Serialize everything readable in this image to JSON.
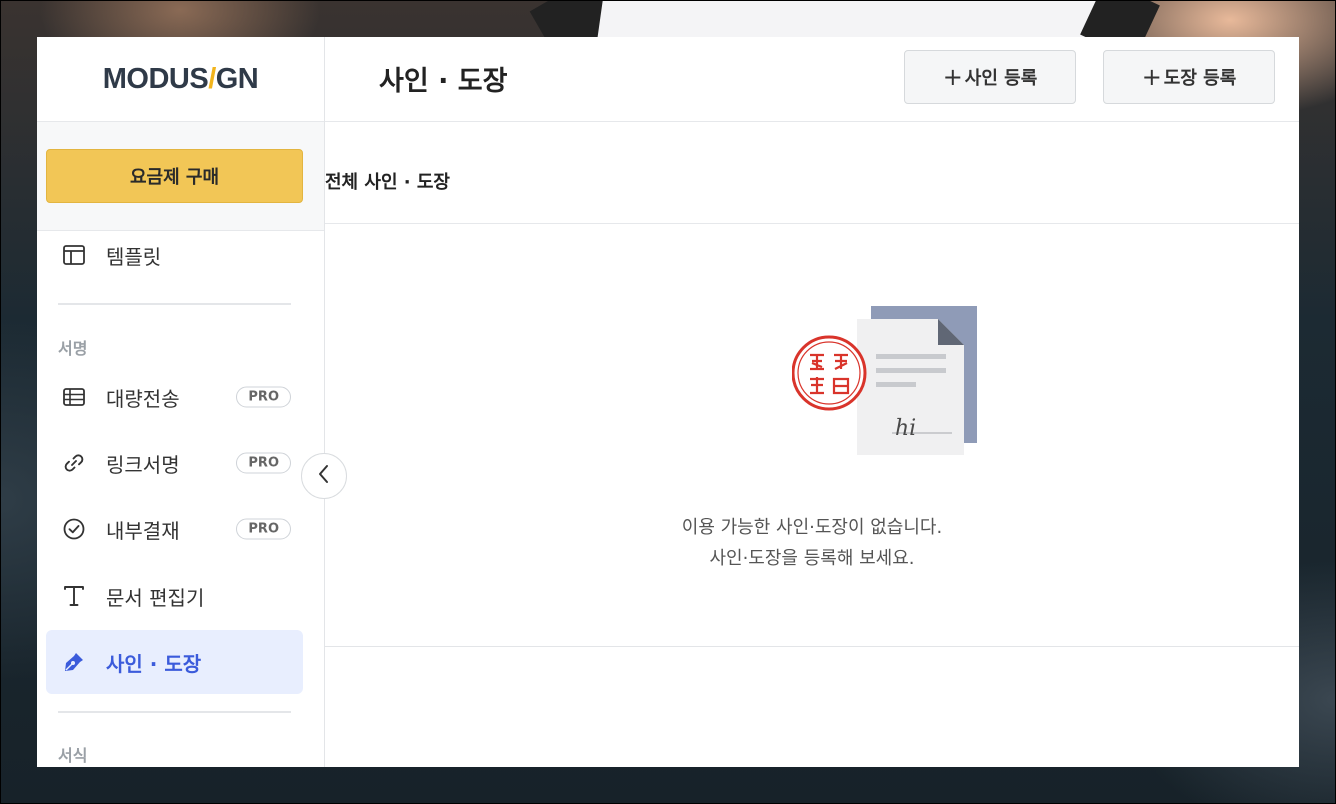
{
  "brand": {
    "logo_left": "MODUS",
    "logo_slash": "/",
    "logo_right": "GN"
  },
  "sidebar": {
    "plan_button": "요금제 구매",
    "items": [
      {
        "label": "템플릿",
        "icon": "template-icon"
      },
      {
        "label": "대량전송",
        "icon": "table-icon",
        "badge": "PRO"
      },
      {
        "label": "링크서명",
        "icon": "link-icon",
        "badge": "PRO"
      },
      {
        "label": "내부결재",
        "icon": "check-circle-icon",
        "badge": "PRO"
      },
      {
        "label": "문서 편집기",
        "icon": "text-t-icon"
      },
      {
        "label": "사인 · 도장",
        "icon": "pen-nib-icon",
        "active": true
      }
    ],
    "section_sign": "서명",
    "section_form": "서식"
  },
  "header": {
    "title": "사인 · 도장",
    "add_sign_button": "사인 등록",
    "add_stamp_button": "도장 등록",
    "plus": "+"
  },
  "main": {
    "section_title": "전체 사인 · 도장",
    "empty_line1": "이용 가능한 사인·도장이 없습니다.",
    "empty_line2": "사인·도장을 등록해 보세요.",
    "illustration_signature": "hi"
  },
  "colors": {
    "accent": "#3b5bdb",
    "plan_button": "#f2c656",
    "logo_slash": "#f2b41c",
    "stamp_red": "#d9342b"
  }
}
